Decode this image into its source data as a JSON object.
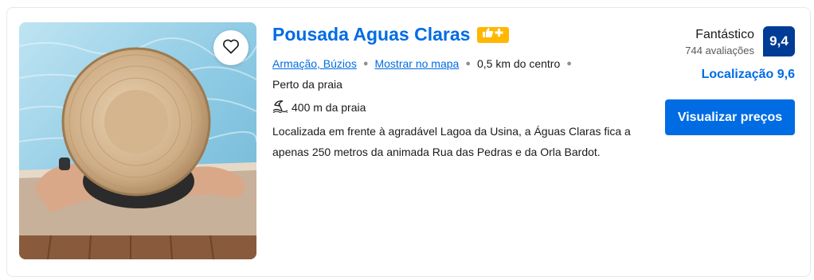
{
  "property": {
    "name": "Pousada Aguas Claras",
    "location_link": "Armação, Búzios",
    "map_link": "Mostrar no mapa",
    "distance_center": "0,5 km do centro",
    "near_beach": "Perto da praia",
    "beach_distance": "400 m da praia",
    "description": "Localizada em frente à agradável Lagoa da Usina, a Águas Claras fica a apenas 250 metros da animada Rua das Pedras e da Orla Bardot."
  },
  "review": {
    "label": "Fantástico",
    "count": "744 avaliações",
    "score": "9,4",
    "location_score": "Localização 9,6"
  },
  "actions": {
    "cta_label": "Visualizar preços"
  },
  "icons": {
    "favorite": "heart-outline-icon",
    "badge": "thumbs-up-plus-icon",
    "beach": "beach-umbrella-icon"
  },
  "colors": {
    "link": "#006ce4",
    "score_bg": "#003b95",
    "badge": "#ffb700",
    "button": "#006ce4"
  }
}
